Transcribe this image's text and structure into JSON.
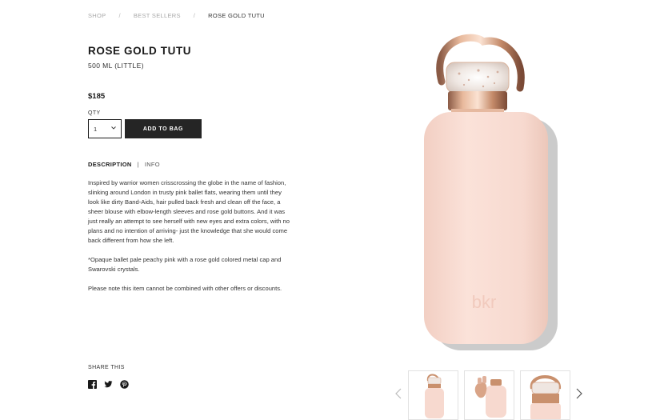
{
  "breadcrumb": {
    "items": [
      "SHOP",
      "BEST SELLERS",
      "ROSE GOLD TUTU"
    ],
    "separator": "/"
  },
  "product": {
    "title": "ROSE GOLD TUTU",
    "subtitle": "500 ML (LITTLE)",
    "price": "$185",
    "qty_label": "QTY",
    "qty_value": "1",
    "add_to_bag_label": "ADD TO BAG",
    "bottle_brand": "bkr"
  },
  "tabs": {
    "description": "DESCRIPTION",
    "divider": "|",
    "info": "INFO"
  },
  "description": {
    "paragraphs": [
      "Inspired by warrior women crisscrossing the globe in the name of fashion, slinking around London in trusty pink ballet flats, wearing them until they look like dirty Band-Aids, hair pulled back fresh and clean off the face, a sheer blouse with elbow-length sleeves and rose gold buttons. And it was just really an attempt to see herself with new eyes and extra colors, with no plans and no intention of arriving- just the knowledge that she would come back different from how she left.",
      "*Opaque ballet pale peachy pink with a rose gold colored metal cap and Swarovski crystals.",
      "Please note this item cannot be combined with other offers or discounts."
    ]
  },
  "share": {
    "label": "SHARE THIS",
    "icons": [
      "facebook-icon",
      "twitter-icon",
      "pinterest-icon"
    ]
  },
  "gallery": {
    "thumbnails": [
      "bottle-front",
      "bottle-in-hand",
      "bottle-cap-closeup"
    ],
    "prev_icon": "chevron-left-icon",
    "next_icon": "chevron-right-icon"
  },
  "colors": {
    "bottle_pink": "#f7d9cf",
    "rose_gold": "#c98f6c",
    "button_dark": "#252525"
  }
}
